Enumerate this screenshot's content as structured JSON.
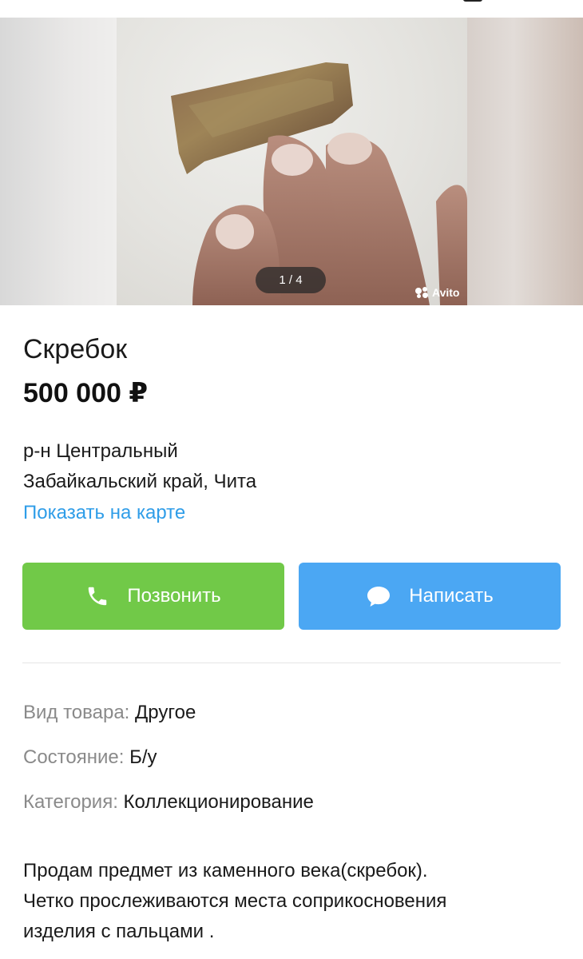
{
  "gallery": {
    "counter": "1 / 4",
    "watermark": "Avito",
    "current_index": 1,
    "total": 4
  },
  "listing": {
    "title": "Скребок",
    "price": "500 000 ₽",
    "district": "р-н Центральный",
    "region_city": "Забайкальский край, Чита",
    "map_link": "Показать на карте"
  },
  "actions": {
    "call_label": "Позвонить",
    "write_label": "Написать",
    "call_color": "#71c948",
    "write_color": "#4ba7f3"
  },
  "params": [
    {
      "key": "Вид товара:",
      "value": "Другое"
    },
    {
      "key": "Состояние:",
      "value": "Б/у"
    },
    {
      "key": "Категория:",
      "value": "Коллекционирование"
    }
  ],
  "description": {
    "lines": [
      "Продам предмет из каменного века(скребок).",
      "Четко прослеживаются места соприкосновения",
      "изделия с пальцами ."
    ]
  },
  "colors": {
    "link": "#2f9de8",
    "muted": "#8a8a8a"
  },
  "icons": {
    "call": "phone-icon",
    "write": "chat-bubble-icon"
  }
}
